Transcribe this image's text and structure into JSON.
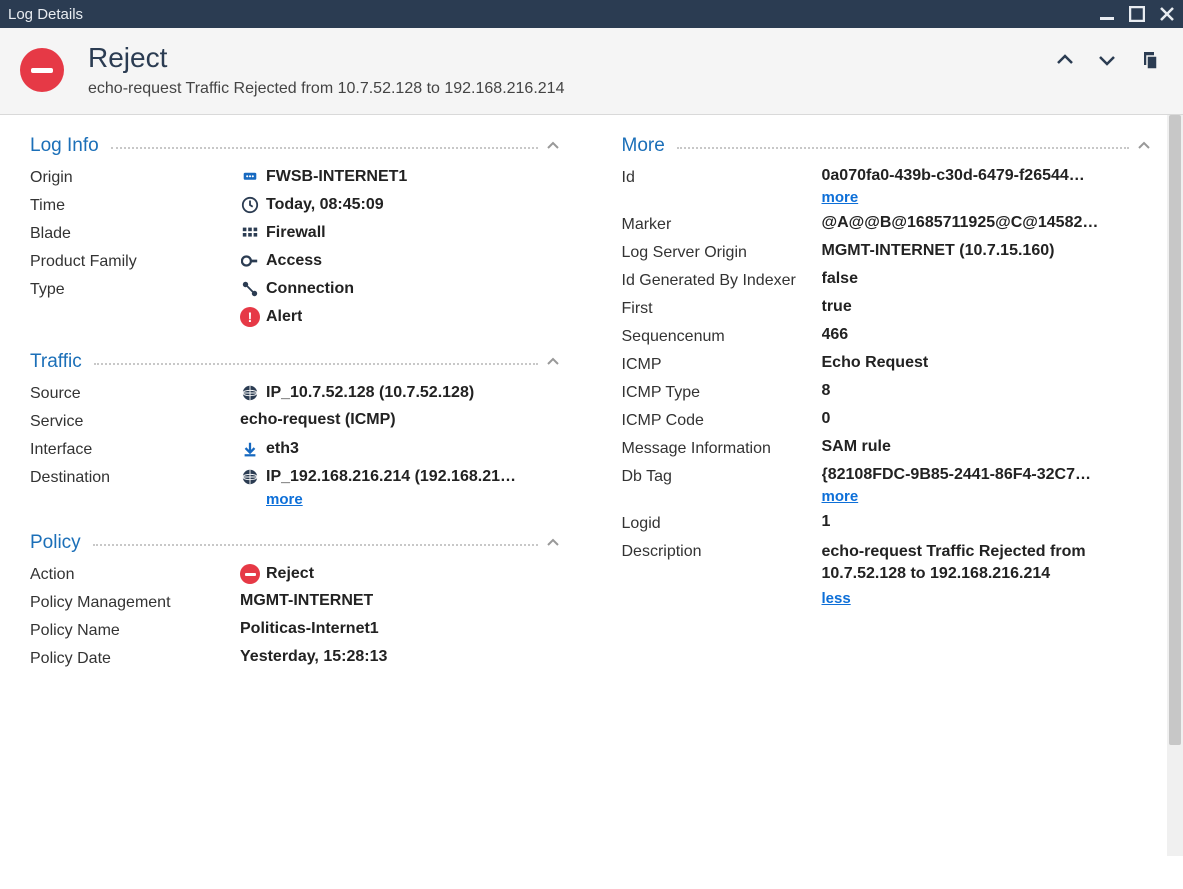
{
  "window": {
    "title": "Log Details"
  },
  "header": {
    "title": "Reject",
    "subtitle": "echo-request Traffic Rejected from 10.7.52.128 to 192.168.216.214"
  },
  "sections": {
    "logInfo": {
      "title": "Log Info",
      "origin_label": "Origin",
      "origin_value": "FWSB-INTERNET1",
      "time_label": "Time",
      "time_value": "Today, 08:45:09",
      "blade_label": "Blade",
      "blade_value": "Firewall",
      "productFamily_label": "Product Family",
      "productFamily_value": "Access",
      "type_label": "Type",
      "type_value": "Connection",
      "alert_value": "Alert"
    },
    "traffic": {
      "title": "Traffic",
      "source_label": "Source",
      "source_value": "IP_10.7.52.128 (10.7.52.128)",
      "service_label": "Service",
      "service_value": "echo-request (ICMP)",
      "interface_label": "Interface",
      "interface_value": "eth3",
      "destination_label": "Destination",
      "destination_value": "IP_192.168.216.214 (192.168.21…",
      "more": "more"
    },
    "policy": {
      "title": "Policy",
      "action_label": "Action",
      "action_value": "Reject",
      "policyMgmt_label": "Policy Management",
      "policyMgmt_value": "MGMT-INTERNET",
      "policyName_label": "Policy Name",
      "policyName_value": "Politicas-Internet1",
      "policyDate_label": "Policy Date",
      "policyDate_value": "Yesterday, 15:28:13"
    },
    "more": {
      "title": "More",
      "id_label": "Id",
      "id_value": "0a070fa0-439b-c30d-6479-f26544…",
      "id_more": "more",
      "marker_label": "Marker",
      "marker_value": "@A@@B@1685711925@C@14582…",
      "logServer_label": "Log Server Origin",
      "logServer_value": "MGMT-INTERNET (10.7.15.160)",
      "idGen_label": "Id Generated By Indexer",
      "idGen_value": "false",
      "first_label": "First",
      "first_value": "true",
      "seq_label": "Sequencenum",
      "seq_value": "466",
      "icmp_label": "ICMP",
      "icmp_value": "Echo Request",
      "icmpType_label": "ICMP Type",
      "icmpType_value": "8",
      "icmpCode_label": "ICMP Code",
      "icmpCode_value": "0",
      "msgInfo_label": "Message Information",
      "msgInfo_value": "SAM rule",
      "dbTag_label": "Db Tag",
      "dbTag_value": "{82108FDC-9B85-2441-86F4-32C7…",
      "dbTag_more": "more",
      "logid_label": "Logid",
      "logid_value": "1",
      "desc_label": "Description",
      "desc_value": "echo-request Traffic Rejected from 10.7.52.128 to 192.168.216.214",
      "desc_less": "less"
    }
  }
}
